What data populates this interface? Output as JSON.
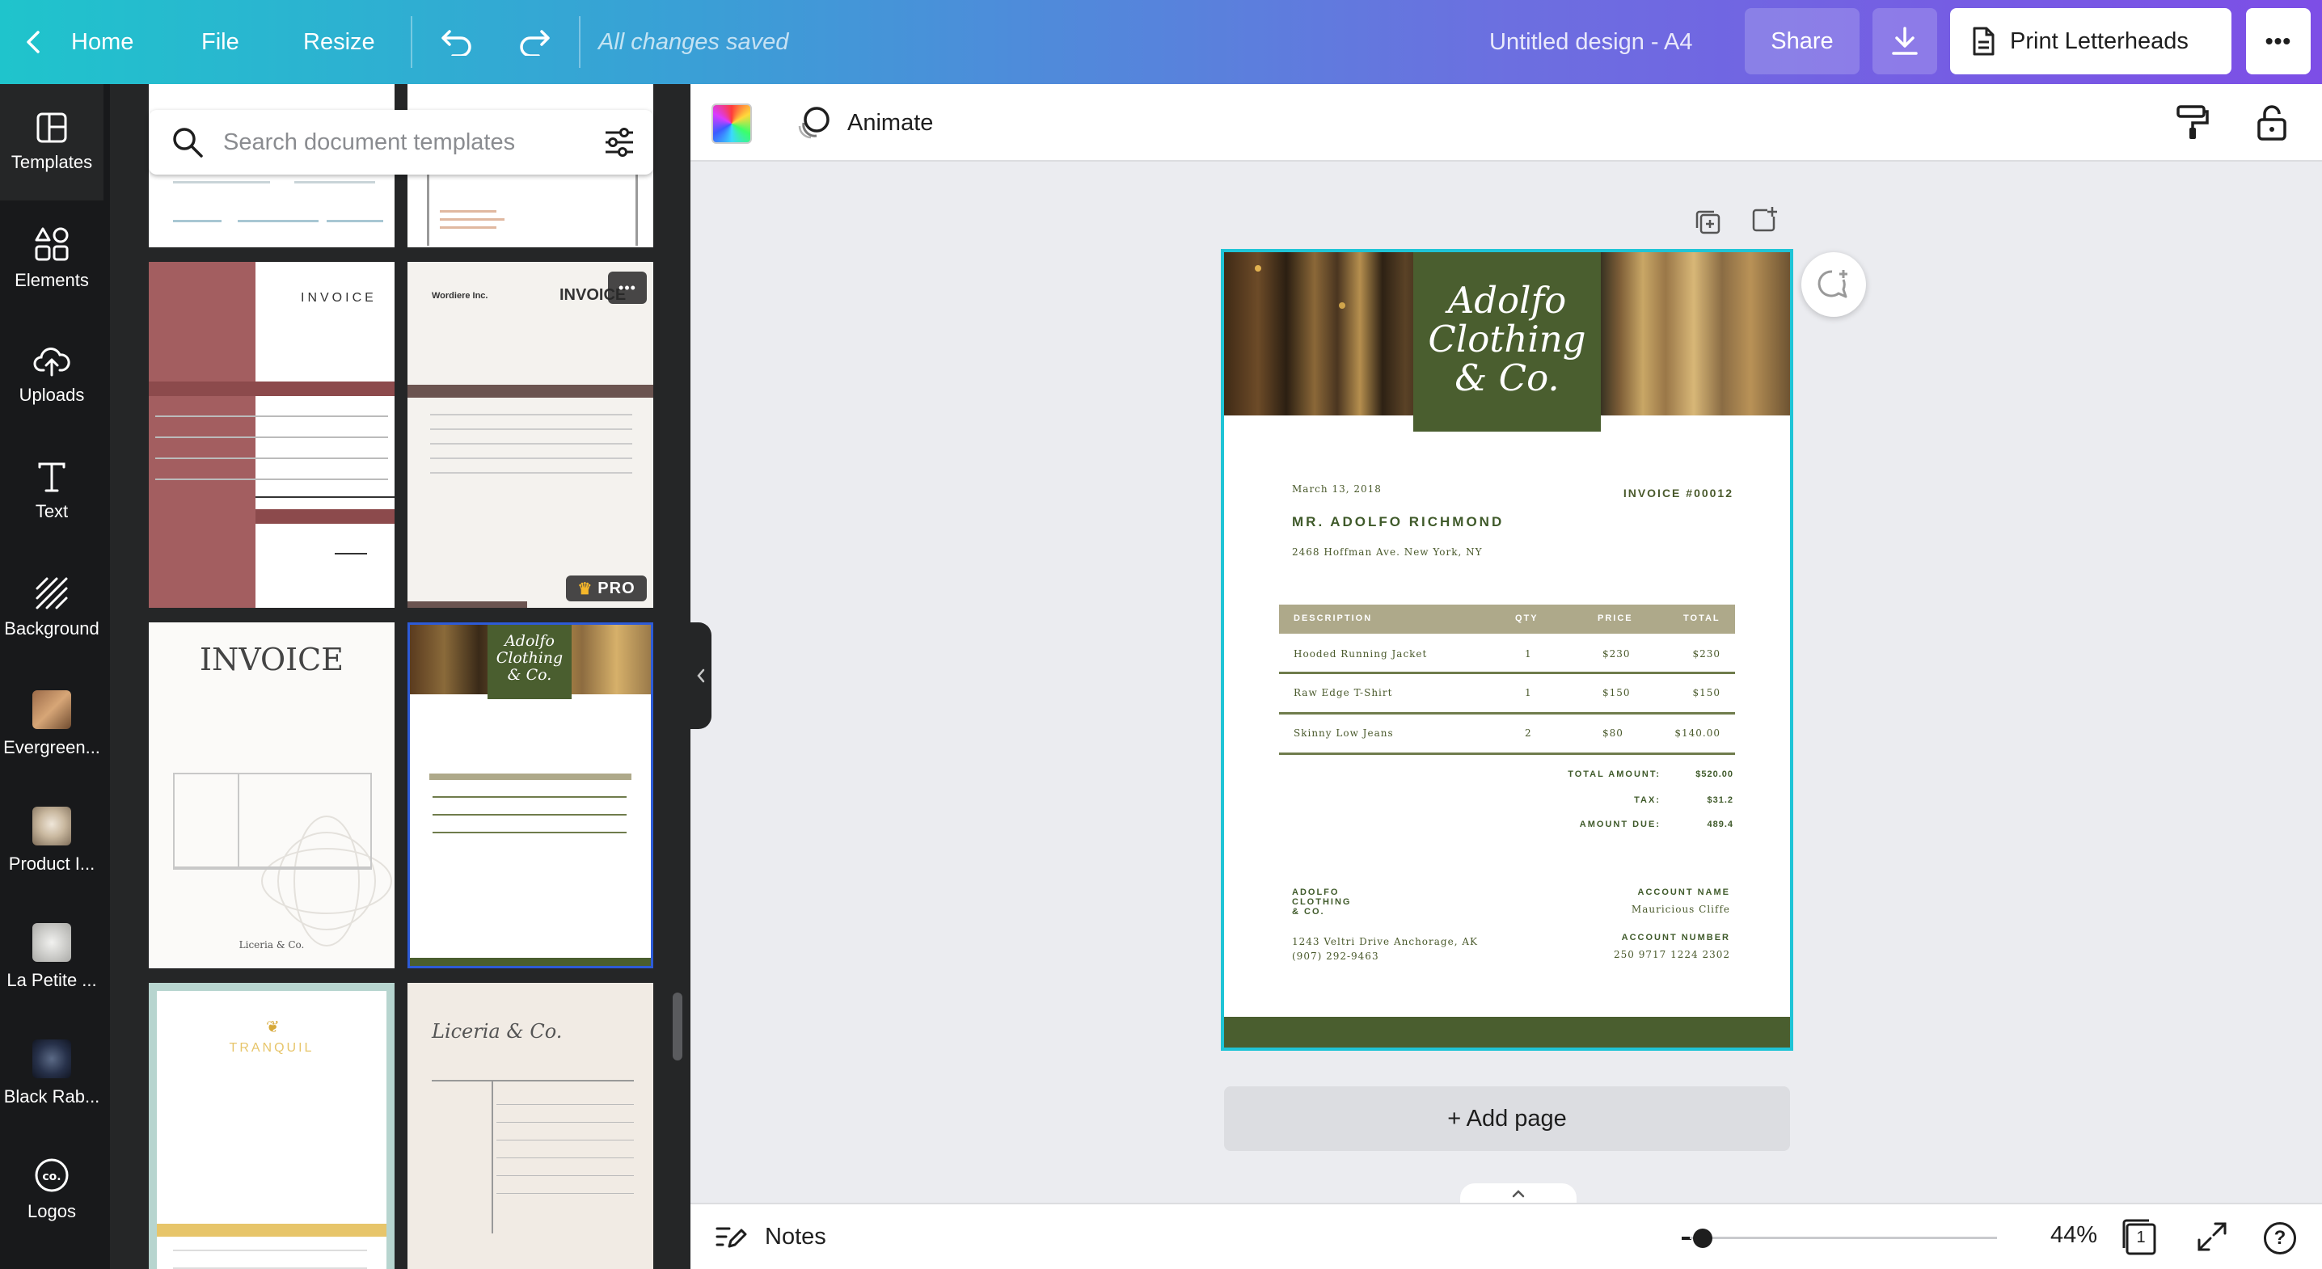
{
  "topbar": {
    "home": "Home",
    "file": "File",
    "resize": "Resize",
    "save_status": "All changes saved",
    "doc_title": "Untitled design - A4",
    "share": "Share",
    "print": "Print Letterheads",
    "more": "•••"
  },
  "sidebar": {
    "items": [
      {
        "label": "Templates",
        "icon": "templates-icon"
      },
      {
        "label": "Elements",
        "icon": "elements-icon"
      },
      {
        "label": "Uploads",
        "icon": "uploads-icon"
      },
      {
        "label": "Text",
        "icon": "text-icon"
      },
      {
        "label": "Background",
        "icon": "background-icon"
      },
      {
        "label": "Evergreen...",
        "icon": "folder-thumb"
      },
      {
        "label": "Product I...",
        "icon": "folder-thumb"
      },
      {
        "label": "La Petite ...",
        "icon": "folder-thumb"
      },
      {
        "label": "Black Rab...",
        "icon": "folder-thumb"
      },
      {
        "label": "Logos",
        "icon": "logos-icon"
      }
    ]
  },
  "panel": {
    "search_placeholder": "Search document templates",
    "pro_badge": "PRO",
    "thumb_texts": {
      "t1_title": "INVOICE",
      "t2_company": "Wordiere Inc.",
      "t2_title": "INVOICE",
      "t3_title": "INVOICE",
      "t3_footer": "Liceria & Co.",
      "t4_brand": "Adolfo Clothing & Co.",
      "t5_brand": "TRANQUIL",
      "t6_brand": "Liceria & Co."
    }
  },
  "context_bar": {
    "animate": "Animate"
  },
  "document": {
    "brand_line1": "Adolfo",
    "brand_line2": "Clothing",
    "brand_line3": "& Co.",
    "date": "March 13, 2018",
    "invoice_no": "INVOICE #00012",
    "client_name": "MR. ADOLFO RICHMOND",
    "client_address": "2468 Hoffman Ave. New York, NY",
    "table_headers": [
      "DESCRIPTION",
      "QTY",
      "PRICE",
      "TOTAL"
    ],
    "rows": [
      {
        "desc": "Hooded Running Jacket",
        "qty": "1",
        "price": "$230",
        "total": "$230"
      },
      {
        "desc": "Raw Edge T-Shirt",
        "qty": "1",
        "price": "$150",
        "total": "$150"
      },
      {
        "desc": "Skinny Low Jeans",
        "qty": "2",
        "price": "$80",
        "total": "$140.00"
      }
    ],
    "totals": [
      {
        "label": "TOTAL AMOUNT:",
        "value": "$520.00"
      },
      {
        "label": "TAX:",
        "value": "$31.2"
      },
      {
        "label": "AMOUNT DUE:",
        "value": "489.4"
      }
    ],
    "footer_company_1": "ADOLFO",
    "footer_company_2": "CLOTHING",
    "footer_company_3": "& CO.",
    "footer_address": "1243 Veltri Drive Anchorage, AK",
    "footer_phone": "(907) 292-9463",
    "account_name_label": "ACCOUNT NAME",
    "account_name": "Mauricious Cliffe",
    "account_number_label": "ACCOUNT NUMBER",
    "account_number": "250 9717 1224 2302"
  },
  "canvas": {
    "add_page": "+ Add page"
  },
  "bottombar": {
    "notes": "Notes",
    "zoom": "44%",
    "page_count": "1",
    "help": "?"
  },
  "colors": {
    "accent_green": "#4a5e2f",
    "table_header": "#aea98a",
    "selection": "#1fc4d6"
  }
}
